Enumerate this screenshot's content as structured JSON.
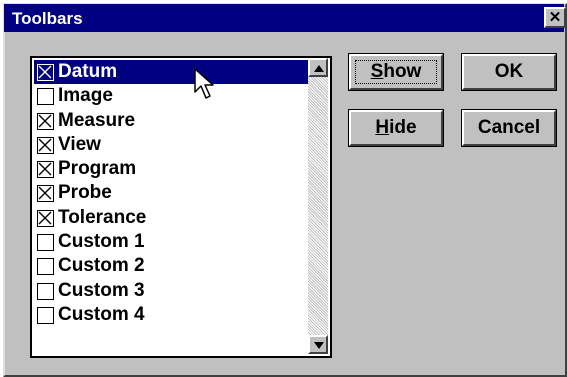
{
  "window": {
    "title": "Toolbars",
    "close_glyph": "✕"
  },
  "list": {
    "items": [
      {
        "label": "Datum",
        "checked": true,
        "selected": true
      },
      {
        "label": "Image",
        "checked": false,
        "selected": false
      },
      {
        "label": "Measure",
        "checked": true,
        "selected": false
      },
      {
        "label": "View",
        "checked": true,
        "selected": false
      },
      {
        "label": "Program",
        "checked": true,
        "selected": false
      },
      {
        "label": "Probe",
        "checked": true,
        "selected": false
      },
      {
        "label": "Tolerance",
        "checked": true,
        "selected": false
      },
      {
        "label": "Custom 1",
        "checked": false,
        "selected": false
      },
      {
        "label": "Custom 2",
        "checked": false,
        "selected": false
      },
      {
        "label": "Custom 3",
        "checked": false,
        "selected": false
      },
      {
        "label": "Custom 4",
        "checked": false,
        "selected": false
      }
    ]
  },
  "buttons": {
    "show_mnemonic": "S",
    "show_rest": "how",
    "hide_mnemonic": "H",
    "hide_rest": "ide",
    "ok": "OK",
    "cancel": "Cancel"
  },
  "colors": {
    "title_bar": "#000080",
    "face": "#c0c0c0",
    "selection": "#000080"
  },
  "icons": {
    "close": "close-icon",
    "scroll_up": "arrow-up-icon",
    "scroll_down": "arrow-down-icon",
    "cursor": "mouse-pointer-icon"
  }
}
